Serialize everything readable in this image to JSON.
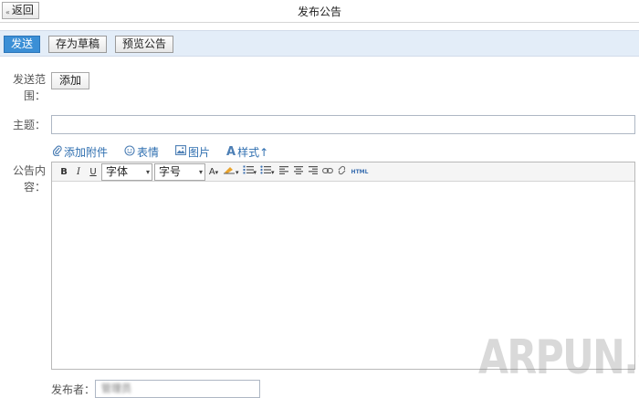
{
  "header": {
    "back_label": "返回",
    "back_icon": "double-chevron-left",
    "title": "发布公告"
  },
  "toolbar": {
    "send_label": "发送",
    "draft_label": "存为草稿",
    "preview_label": "预览公告",
    "accent_color": "#3b8fd6"
  },
  "form": {
    "scope_label_line1": "发送范",
    "scope_label_line2": "围：",
    "add_label": "添加",
    "subject_label": "主题：",
    "subject_value": "",
    "content_label_line1": "公告内",
    "content_label_line2": "容：",
    "publisher_label": "发布者：",
    "publisher_value": "管理员"
  },
  "attach_bar": {
    "attachment": "添加附件",
    "emoji": "表情",
    "image": "图片",
    "style": "样式↑"
  },
  "editor": {
    "bold": "B",
    "italic": "I",
    "underline": "U",
    "font_family": "字体",
    "font_size": "字号",
    "font_color": "A",
    "html": "HTML"
  },
  "watermark": "ARPUN.COM"
}
